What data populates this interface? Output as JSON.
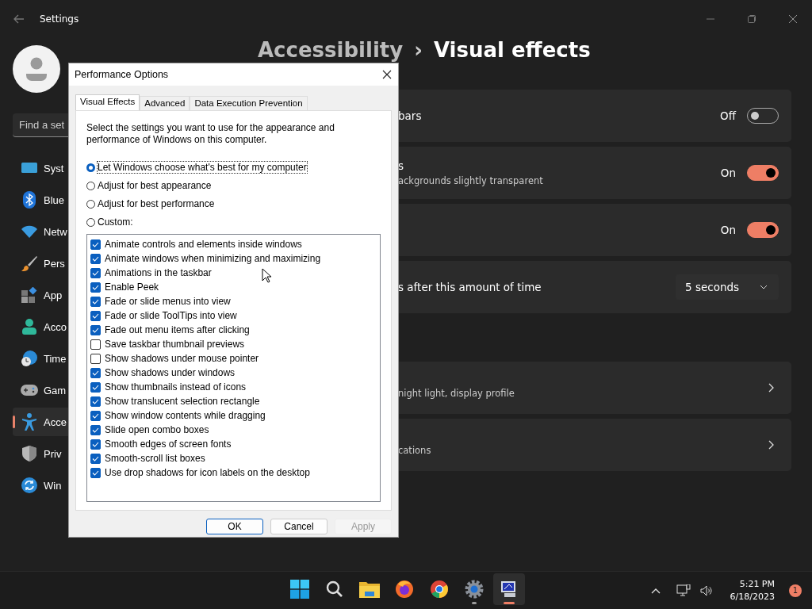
{
  "settings_window": {
    "title": "Settings"
  },
  "search": {
    "placeholder": "Find a set"
  },
  "sidebar": {
    "items": [
      {
        "kind": "system",
        "label": "Syst",
        "selected": false
      },
      {
        "kind": "bluetooth",
        "label": "Blue",
        "selected": false
      },
      {
        "kind": "network",
        "label": "Netw",
        "selected": false
      },
      {
        "kind": "personalization",
        "label": "Pers",
        "selected": false
      },
      {
        "kind": "apps",
        "label": "App",
        "selected": false
      },
      {
        "kind": "accounts",
        "label": "Acco",
        "selected": false
      },
      {
        "kind": "time",
        "label": "Time",
        "selected": false
      },
      {
        "kind": "gaming",
        "label": "Gam",
        "selected": false
      },
      {
        "kind": "accessibility",
        "label": "Acce",
        "selected": true
      },
      {
        "kind": "privacy",
        "label": "Priv",
        "selected": false
      },
      {
        "kind": "update",
        "label": "Win",
        "selected": false
      }
    ]
  },
  "breadcrumb": {
    "parent": "Accessibility",
    "separator": "›",
    "current": "Visual effects"
  },
  "settings": [
    {
      "kind": "toggle",
      "title": "bars",
      "state_label": "Off",
      "on": false
    },
    {
      "kind": "toggle",
      "title": "s",
      "description": "ackgrounds slightly transparent",
      "state_label": "On",
      "on": true
    },
    {
      "kind": "toggle",
      "state_label": "On",
      "on": true
    },
    {
      "kind": "dropdown",
      "title": "s after this amount of time",
      "value": "5 seconds"
    }
  ],
  "related": [
    {
      "description": "night light, display profile"
    },
    {
      "description": "cations"
    }
  ],
  "dialog": {
    "title": "Performance Options",
    "tabs": [
      {
        "label": "Visual Effects",
        "selected": true
      },
      {
        "label": "Advanced",
        "selected": false
      },
      {
        "label": "Data Execution Prevention",
        "selected": false
      }
    ],
    "intro": "Select the settings you want to use for the appearance and performance of Windows on this computer.",
    "options": [
      {
        "label": "Let Windows choose what's best for my computer",
        "selected": true
      },
      {
        "label": "Adjust for best appearance",
        "selected": false
      },
      {
        "label": "Adjust for best performance",
        "selected": false
      },
      {
        "label": "Custom:",
        "selected": false
      }
    ],
    "effects": [
      {
        "label": "Animate controls and elements inside windows",
        "checked": true
      },
      {
        "label": "Animate windows when minimizing and maximizing",
        "checked": true
      },
      {
        "label": "Animations in the taskbar",
        "checked": true
      },
      {
        "label": "Enable Peek",
        "checked": true
      },
      {
        "label": "Fade or slide menus into view",
        "checked": true
      },
      {
        "label": "Fade or slide ToolTips into view",
        "checked": true
      },
      {
        "label": "Fade out menu items after clicking",
        "checked": true
      },
      {
        "label": "Save taskbar thumbnail previews",
        "checked": false
      },
      {
        "label": "Show shadows under mouse pointer",
        "checked": false
      },
      {
        "label": "Show shadows under windows",
        "checked": true
      },
      {
        "label": "Show thumbnails instead of icons",
        "checked": true
      },
      {
        "label": "Show translucent selection rectangle",
        "checked": true
      },
      {
        "label": "Show window contents while dragging",
        "checked": true
      },
      {
        "label": "Slide open combo boxes",
        "checked": true
      },
      {
        "label": "Smooth edges of screen fonts",
        "checked": true
      },
      {
        "label": "Smooth-scroll list boxes",
        "checked": true
      },
      {
        "label": "Use drop shadows for icon labels on the desktop",
        "checked": true
      }
    ],
    "buttons": [
      {
        "label": "OK",
        "default": true,
        "disabled": false
      },
      {
        "label": "Cancel",
        "default": false,
        "disabled": false
      },
      {
        "label": "Apply",
        "default": false,
        "disabled": true
      }
    ]
  },
  "taskbar": {
    "apps": [
      {
        "kind": "start",
        "running": false,
        "selected": false
      },
      {
        "kind": "search",
        "running": false,
        "selected": false
      },
      {
        "kind": "files",
        "running": false,
        "selected": false
      },
      {
        "kind": "firefox",
        "running": false,
        "selected": false
      },
      {
        "kind": "chrome",
        "running": false,
        "selected": false
      },
      {
        "kind": "settings",
        "running": true,
        "selected": false
      },
      {
        "kind": "performance",
        "running": true,
        "selected": true
      }
    ],
    "time": "5:21 PM",
    "date": "6/18/2023",
    "notifications": "1"
  }
}
